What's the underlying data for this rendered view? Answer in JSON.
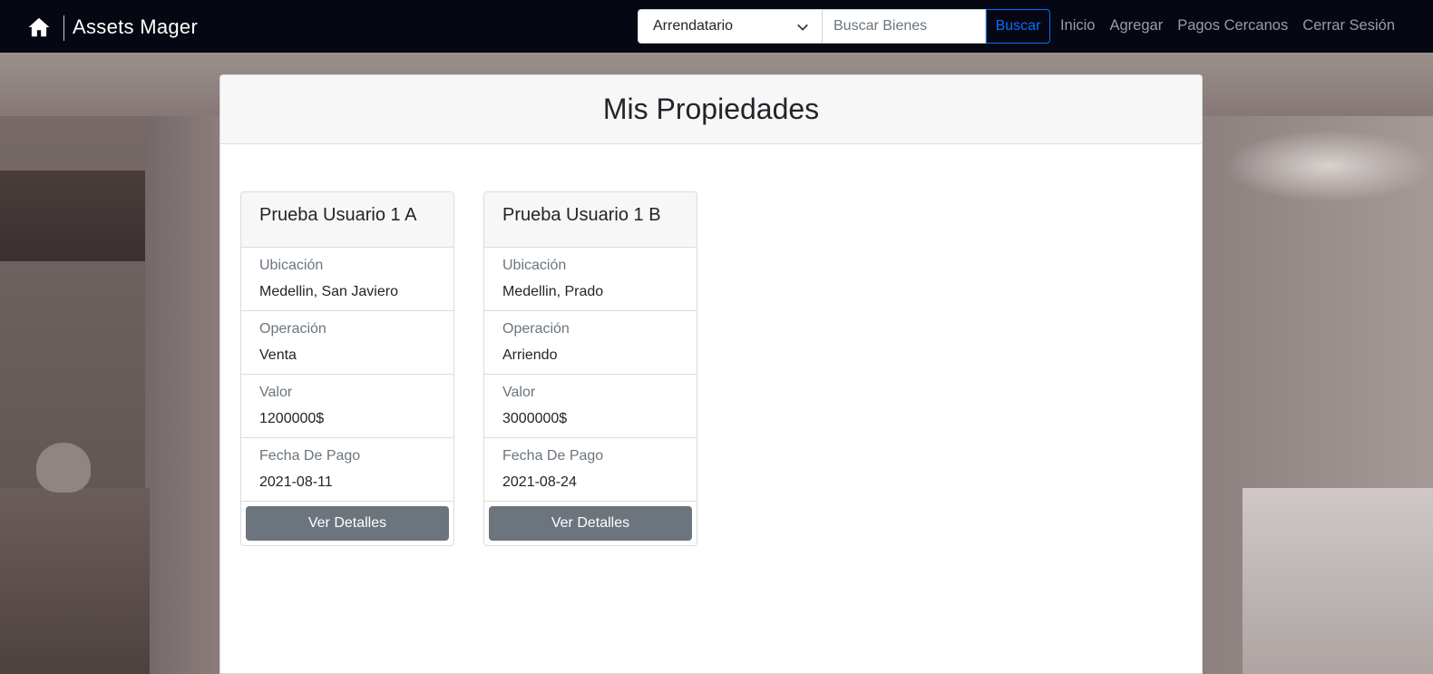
{
  "navbar": {
    "brand": "Assets Mager",
    "role_select": {
      "selected": "Arrendatario"
    },
    "search": {
      "placeholder": "Buscar Bienes",
      "value": "",
      "button_label": "Buscar"
    },
    "links": [
      "Inicio",
      "Agregar",
      "Pagos Cercanos",
      "Cerrar Sesión"
    ]
  },
  "main": {
    "title": "Mis Propiedades",
    "properties": [
      {
        "title": "Prueba Usuario 1 A",
        "fields": [
          {
            "label": "Ubicación",
            "value": "Medellin, San Javiero"
          },
          {
            "label": "Operación",
            "value": "Venta"
          },
          {
            "label": "Valor",
            "value": "1200000$"
          },
          {
            "label": "Fecha De Pago",
            "value": "2021-08-11"
          }
        ],
        "button_label": "Ver Detalles"
      },
      {
        "title": "Prueba Usuario 1 B",
        "fields": [
          {
            "label": "Ubicación",
            "value": "Medellin, Prado"
          },
          {
            "label": "Operación",
            "value": "Arriendo"
          },
          {
            "label": "Valor",
            "value": "3000000$"
          },
          {
            "label": "Fecha De Pago",
            "value": "2021-08-24"
          }
        ],
        "button_label": "Ver Detalles"
      }
    ]
  },
  "colors": {
    "navbar_bg": "#050712",
    "search_button": "#0d6efd",
    "details_button": "#6c757d"
  },
  "icons": {
    "home": "home-icon",
    "select_chevron": "chevron-down-icon"
  }
}
